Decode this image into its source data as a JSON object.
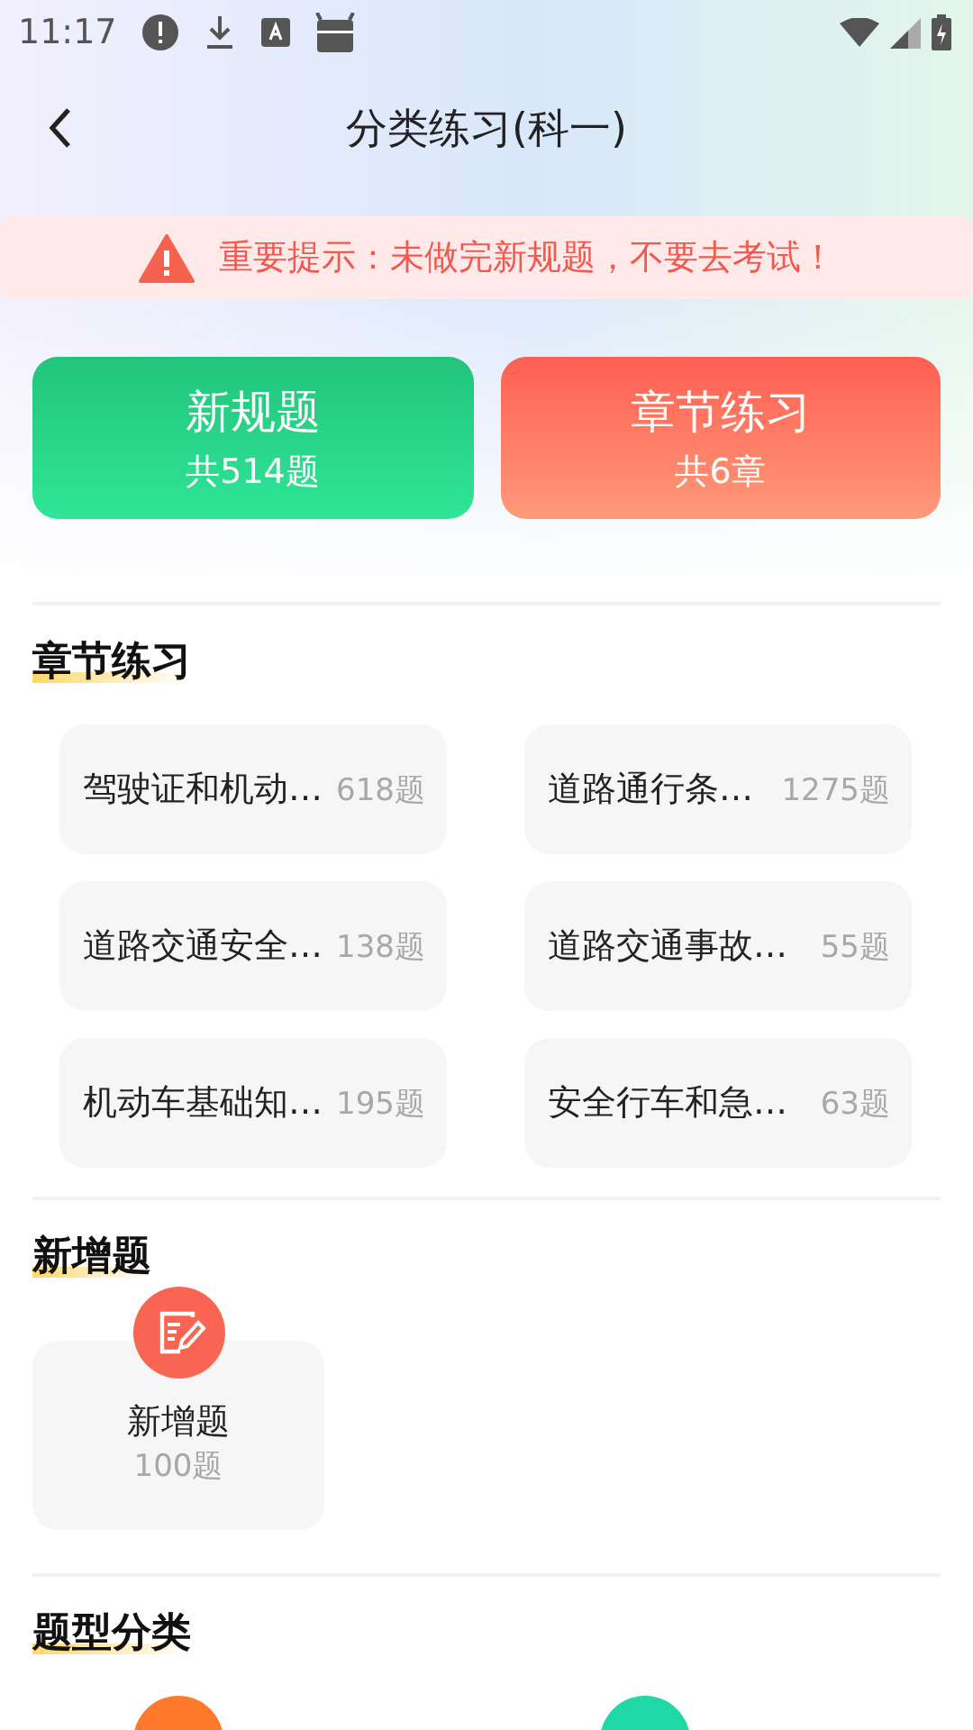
{
  "status_bar": {
    "time": "11:17"
  },
  "header": {
    "title": "分类练习(科一)"
  },
  "notice": {
    "text": "重要提示：未做完新规题，不要去考试！"
  },
  "modes": [
    {
      "kind": "green",
      "title": "新规题",
      "subtitle": "共514题"
    },
    {
      "kind": "red",
      "title": "章节练习",
      "subtitle": "共6章"
    }
  ],
  "sections": [
    {
      "kind": "chapters",
      "title": "章节练习",
      "items": [
        {
          "name": "驾驶证和机动…",
          "count": "618题"
        },
        {
          "name": "道路通行条…",
          "count": "1275题"
        },
        {
          "name": "道路交通安全…",
          "count": "138题"
        },
        {
          "name": "道路交通事故…",
          "count": "55题"
        },
        {
          "name": "机动车基础知…",
          "count": "195题"
        },
        {
          "name": "安全行车和急…",
          "count": "63题"
        }
      ]
    },
    {
      "kind": "cards",
      "title": "新增题",
      "items": [
        {
          "name": "新增题",
          "count": "100题"
        }
      ]
    },
    {
      "kind": "icons",
      "title": "题型分类",
      "items": [
        {
          "color": "#ff7a2a"
        },
        {
          "color": "#1ed8a8"
        }
      ]
    }
  ]
}
